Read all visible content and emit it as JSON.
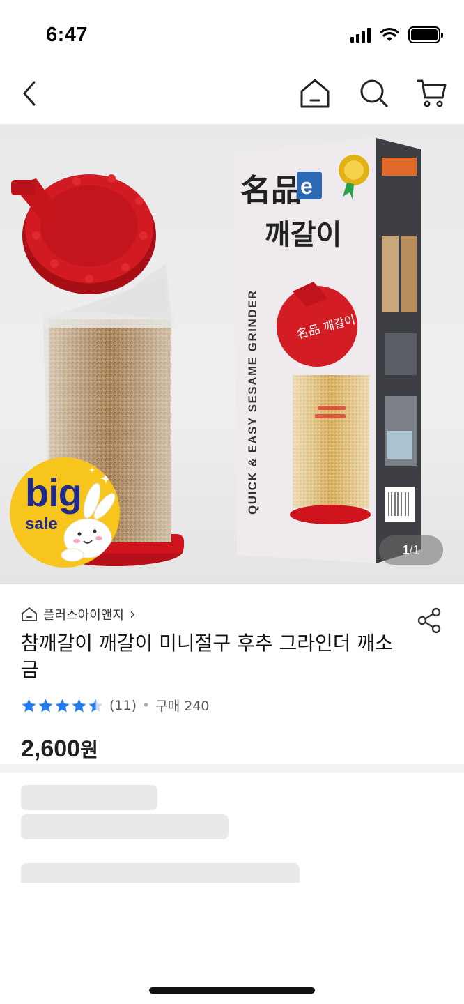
{
  "status_bar": {
    "time": "6:47",
    "icons": [
      "signal-icon",
      "wifi-icon",
      "battery-icon"
    ]
  },
  "nav": {
    "icons": [
      "chevron-left-icon",
      "home-icon",
      "search-icon",
      "cart-icon"
    ]
  },
  "gallery": {
    "pager_current": "1",
    "pager_total": "/1",
    "badge_big": "big",
    "badge_sale": "sale",
    "package_title": "名品",
    "package_name": "깨갈이",
    "package_side_text": "QUICK & EASY SESAME GRINDER",
    "lid_text": "名品 깨갈이"
  },
  "product": {
    "store_name": "플러스아이앤지",
    "store_chevron": "›",
    "title": "참깨갈이 깨갈이 미니절구 후추 그라인더  깨소금",
    "rating_stars": 4.5,
    "review_count": "(11)",
    "separator": "•",
    "purchase_label": "구매 240",
    "price_value": "2,600",
    "price_unit": "원"
  },
  "colors": {
    "accent_star": "#1e7bf0",
    "badge_yellow": "#f7c51c",
    "badge_text": "#1f2a8c",
    "lid_red": "#c9161f"
  }
}
